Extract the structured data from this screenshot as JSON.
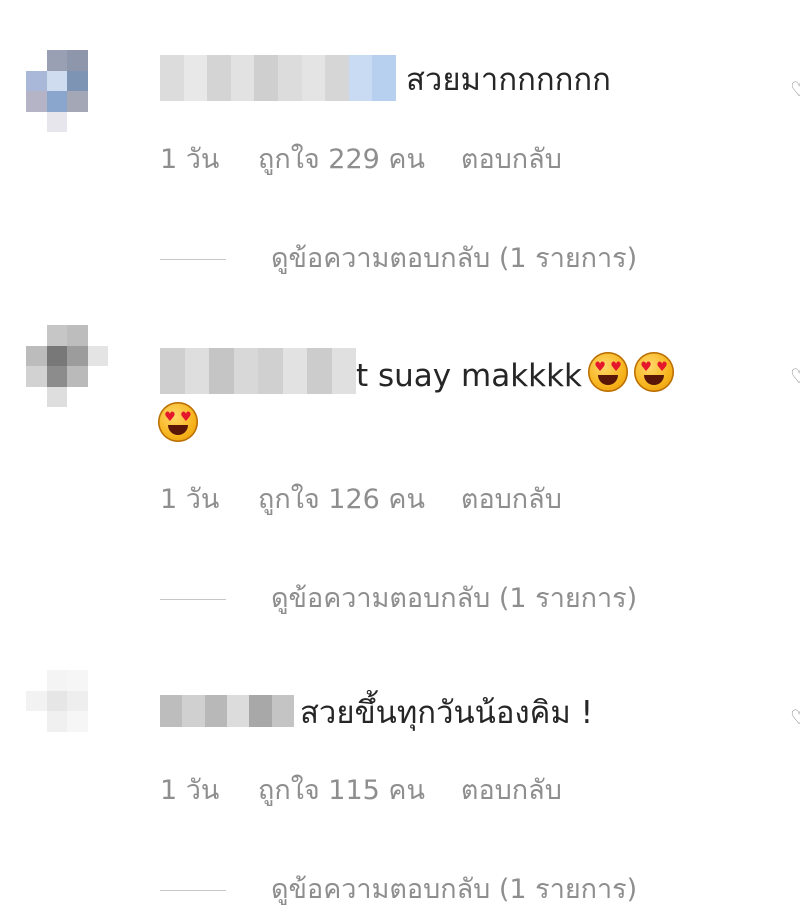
{
  "comments": [
    {
      "text": "สวยมากกกกกก",
      "time": "1 วัน",
      "likes": "ถูกใจ 229 คน",
      "reply": "ตอบกลับ",
      "view_replies": "ดูข้อความตอบกลับ (1 รายการ)"
    },
    {
      "text": "t suay makkkk",
      "time": "1 วัน",
      "likes": "ถูกใจ 126 คน",
      "reply": "ตอบกลับ",
      "view_replies": "ดูข้อความตอบกลับ (1 รายการ)"
    },
    {
      "text": "สวยขึ้นทุกวันน้องคิม !",
      "time": "1 วัน",
      "likes": "ถูกใจ 115 คน",
      "reply": "ตอบกลับ",
      "view_replies": "ดูข้อความตอบกลับ (1 รายการ)"
    }
  ],
  "icons": {
    "like": "heart-outline-icon",
    "emoji": "heart-eyes-emoji"
  },
  "colors": {
    "text": "#262626",
    "secondary": "#8e8e8e",
    "divider": "#c7c7c7"
  }
}
